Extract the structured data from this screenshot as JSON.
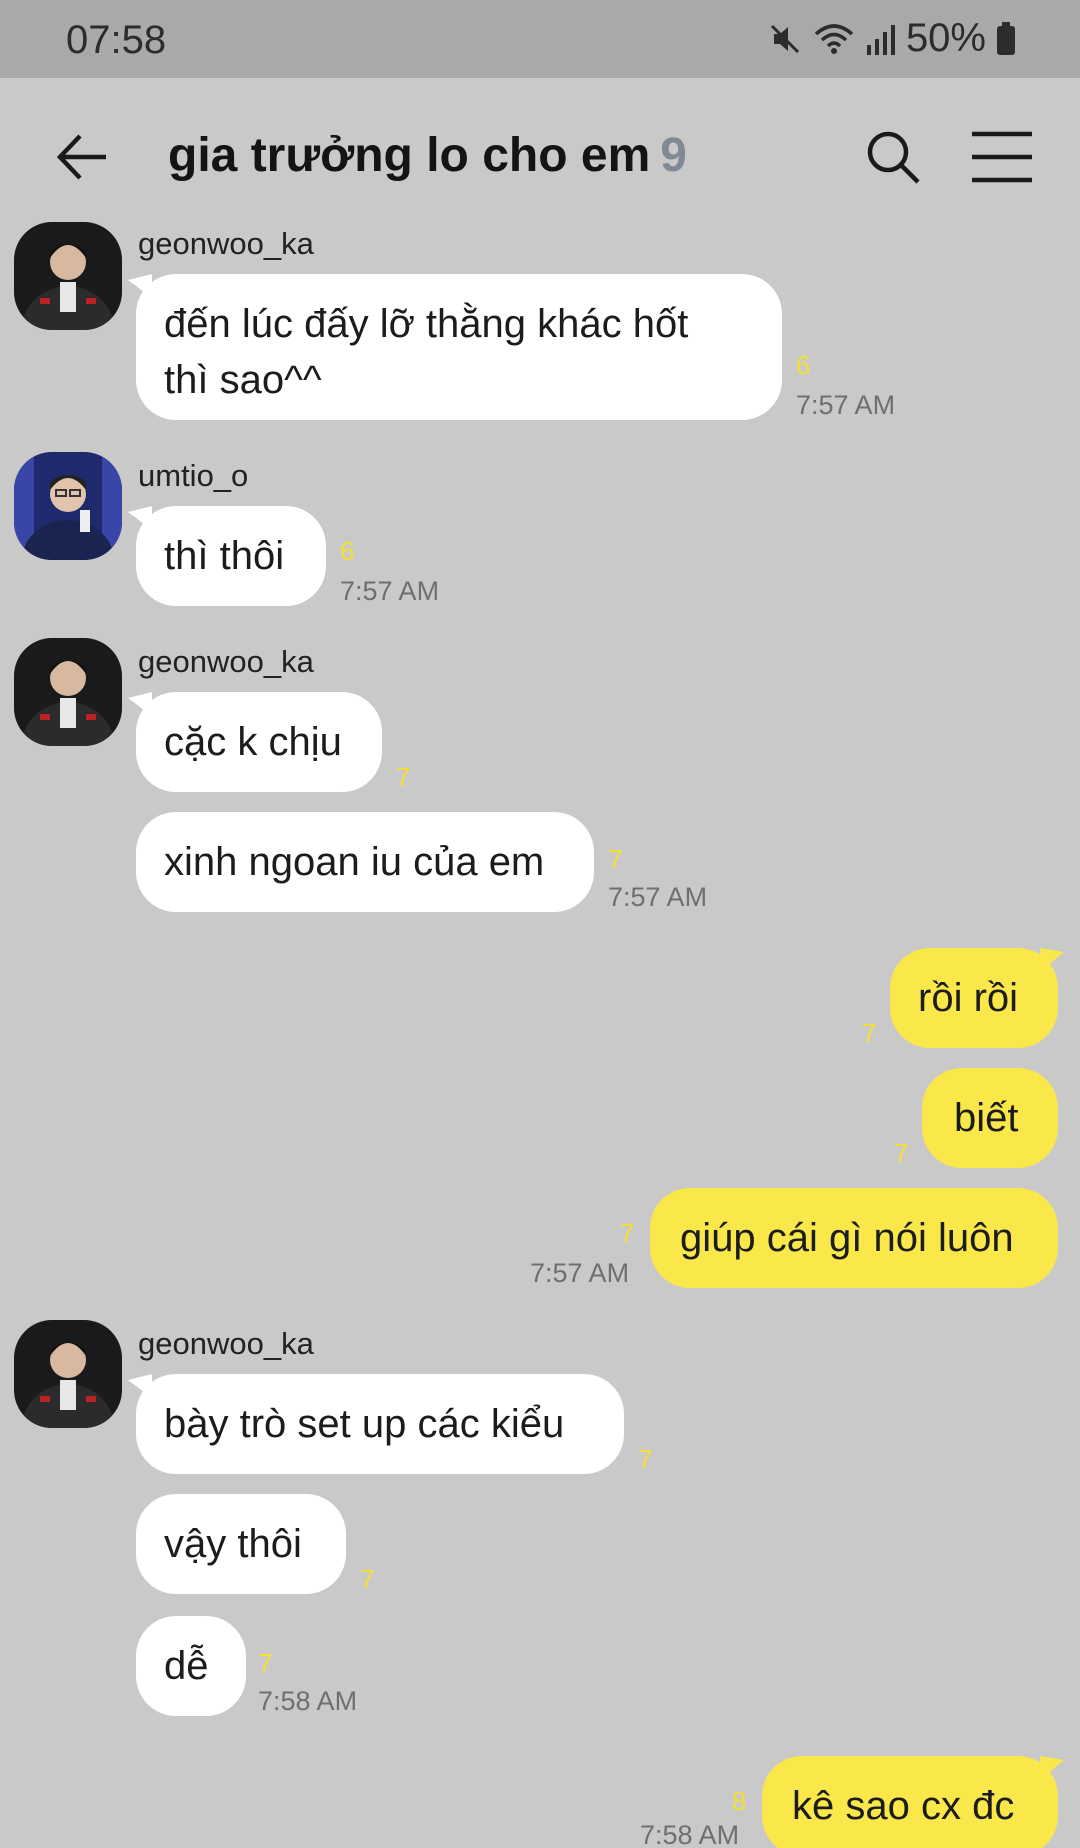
{
  "status_bar": {
    "time": "07:58",
    "battery": "50%",
    "icons": [
      "mute-icon",
      "wifi-icon",
      "signal-icon",
      "battery-icon"
    ]
  },
  "header": {
    "title": "gia trưởng lo cho em",
    "member_count": "9",
    "icons": [
      "back-arrow-icon",
      "search-icon",
      "menu-icon"
    ]
  },
  "colors": {
    "background": "#c9c9c9",
    "incoming_bubble": "#ffffff",
    "outgoing_bubble": "#fae84b",
    "unread": "#f4df35"
  },
  "messages": [
    {
      "sender": "geonwoo_ka",
      "text_line1": "đến lúc đấy lỡ thằng khác hốt",
      "text_line2": "thì sao^^",
      "unread": "6",
      "time": "7:57 AM"
    },
    {
      "sender": "umtio_o",
      "text": "thì thôi",
      "unread": "6",
      "time": "7:57 AM"
    },
    {
      "sender": "geonwoo_ka",
      "text": "cặc k chịu",
      "unread": "7"
    },
    {
      "text": "xinh ngoan iu của em",
      "unread": "7",
      "time": "7:57 AM"
    },
    {
      "text": "rồi rồi",
      "unread": "7"
    },
    {
      "text": "biết",
      "unread": "7"
    },
    {
      "text": "giúp cái gì nói luôn",
      "unread": "7",
      "time": "7:57 AM"
    },
    {
      "sender": "geonwoo_ka",
      "text": "bày trò set up các kiểu",
      "unread": "7"
    },
    {
      "text": "vậy thôi",
      "unread": "7"
    },
    {
      "text": "dễ",
      "unread": "7",
      "time": "7:58 AM"
    },
    {
      "text": "kê sao cx đc",
      "unread": "8",
      "time": "7:58 AM"
    }
  ]
}
